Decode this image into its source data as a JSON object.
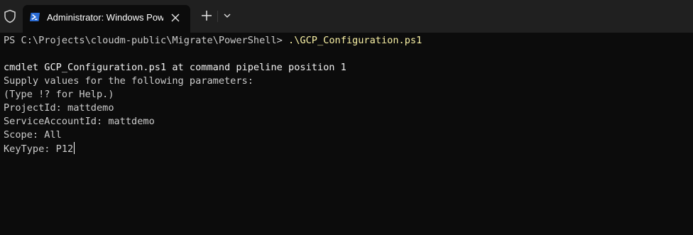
{
  "window": {
    "tab_title": "Administrator: Windows Powe",
    "shield_icon": "shield-icon",
    "tab_icon": "powershell-icon",
    "close_icon": "close-icon",
    "new_tab_icon": "plus-icon",
    "dropdown_icon": "chevron-down-icon"
  },
  "terminal": {
    "prompt": "PS C:\\Projects\\cloudm-public\\Migrate\\PowerShell> ",
    "command": ".\\GCP_Configuration.ps1",
    "cmdlet_line": "cmdlet GCP_Configuration.ps1 at command pipeline position 1",
    "supply_line": "Supply values for the following parameters:",
    "help_line": "(Type !? for Help.)",
    "project_line": "ProjectId: mattdemo",
    "service_line": "ServiceAccountId: mattdemo",
    "scope_line": "Scope: All",
    "keytype_line": "KeyType: P12"
  },
  "colors": {
    "background": "#0c0c0c",
    "tabbar": "#202020",
    "text": "#cccccc",
    "command": "#f9f1a5",
    "powershell_blue": "#2b6cd4"
  }
}
